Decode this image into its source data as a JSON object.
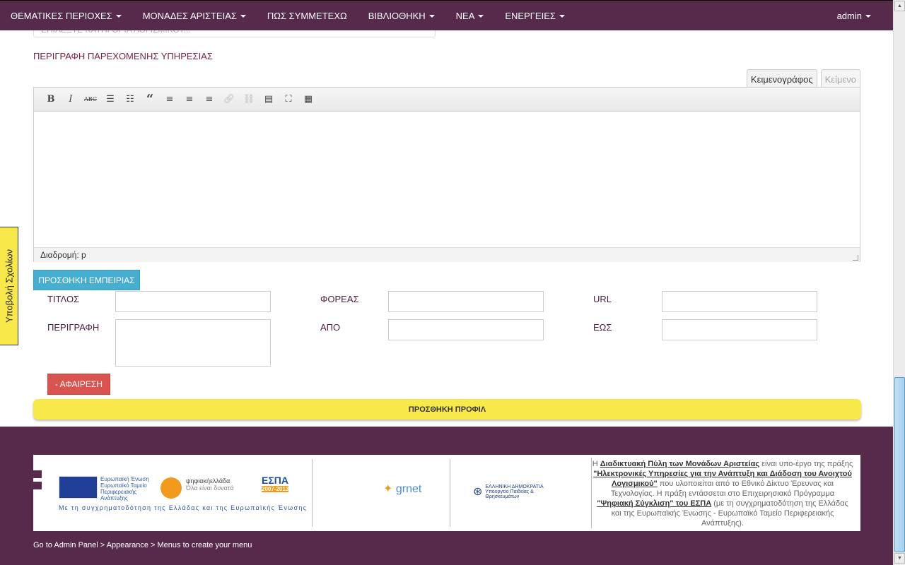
{
  "nav": {
    "items": [
      {
        "label": "ΘΕΜΑΤΙΚΕΣ ΠΕΡΙΟΧΕΣ",
        "dropdown": true
      },
      {
        "label": "ΜΟΝΑΔΕΣ ΑΡΙΣΤΕΙΑΣ",
        "dropdown": true
      },
      {
        "label": "ΠΩΣ ΣΥΜΜΕΤΕΧΩ",
        "dropdown": false
      },
      {
        "label": "ΒΙΒΛΙΟΘΗΚΗ",
        "dropdown": true
      },
      {
        "label": "ΝΕΑ",
        "dropdown": true
      },
      {
        "label": "ΕΝΕΡΓΕΙΕΣ",
        "dropdown": true
      }
    ],
    "user": "admin"
  },
  "form": {
    "category_placeholder": "ΕΠΙΛΕΞΤΕ ΚΑΤΗΓΟΡΙΑ ΛΟΓΙΣΜΙΚΟΥ...",
    "description_label": "ΠΕΡΙΓΡΑΦΗ ΠΑΡΕΧΟΜΕΝΗΣ ΥΠΗΡΕΣΙΑΣ",
    "editor_tabs": [
      "Κειμενογράφος",
      "Κείμενο"
    ],
    "toolbar": [
      "bold",
      "italic",
      "strikethrough",
      "bullet-list",
      "numbered-list",
      "blockquote",
      "align-left",
      "align-center",
      "align-right",
      "link",
      "unlink",
      "more",
      "fullscreen",
      "toolbar-toggle"
    ],
    "path_label": "Διαδρομή: p",
    "add_experience": "ΠΡΟΣΘΗΚΗ ΕΜΠΕΙΡΙΑΣ",
    "fields": {
      "title": "ΤΙΤΛΟΣ",
      "org": "ΦΟΡΕΑΣ",
      "url": "URL",
      "description": "ΠΕΡΙΓΡΑΦΗ",
      "from": "ΑΠΟ",
      "to": "ΕΩΣ"
    },
    "remove": "- ΑΦΑΙΡΕΣΗ",
    "submit": "ΠΡΟΣΘΗΚΗ ΠΡΟΦΙΛ"
  },
  "side_tab": "Υποβολή Σχολίων",
  "footer": {
    "eu_text": [
      "Ευρωπαϊκή Ένωση",
      "Ευρωπαϊκό Ταμείο",
      "Περιφερειακής",
      "Ανάπτυξης"
    ],
    "digital_greece": "ψηφιακήελλάδα",
    "digital_greece_sub": "Όλα είναι δυνατά",
    "espa": "ΕΣΠΑ",
    "espa_years": "2007-2013",
    "slogan": "Με τη συγχρηματοδότηση της Ελλάδας και της Ευρωπαϊκής Ένωσης",
    "grnet": "grnet",
    "ministry": [
      "ΕΛΛΗΝΙΚΗ ΔΗΜΟΚΡΑΤΙΑ",
      "Υπουργείο Παιδείας & Θρησκευμάτων"
    ],
    "text": {
      "p1": "Η ",
      "l1": "Διαδικτυακή Πύλη των Μονάδων Αριστείας",
      "p2": " είναι υπο-έργο της πράξης ",
      "l2": "\"Ηλεκτρονικές Υπηρεσίες για την Ανάπτυξη και Διάδοση του Ανοιχτού Λογισμικού\"",
      "p3": " που υλοποιείται από το Εθνικό Δίκτυο Έρευνας και Τεχνολογίας. Η πράξη εντάσσεται στο Επιχειρησιακό Πρόγραμμα ",
      "l3": "\"Ψηφιακή Σύγκλιση\" του ΕΣΠΑ",
      "p4": " (με τη συγχρηματοδότηση της Ελλάδας και της Ευρωπαϊκής Ένωσης - Ευρωπαϊκό Ταμείο Περιφερειακής Ανάπτυξης)."
    },
    "menu_note": "Go to Admin Panel > Appearance > Menus to create your menu"
  }
}
